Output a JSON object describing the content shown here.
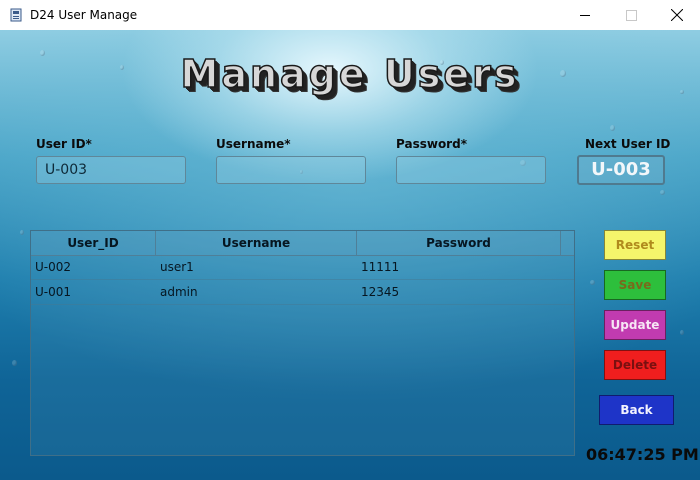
{
  "window": {
    "title": "D24 User Manage",
    "icon": "app-icon"
  },
  "page": {
    "heading": "Manage Users"
  },
  "form": {
    "user_id": {
      "label": "User ID*",
      "value": "U-003"
    },
    "username": {
      "label": "Username*",
      "value": ""
    },
    "password": {
      "label": "Password*",
      "value": ""
    },
    "next_user_id": {
      "label": "Next User ID",
      "value": "U-003"
    }
  },
  "table": {
    "columns": [
      "User_ID",
      "Username",
      "Password"
    ],
    "rows": [
      [
        "U-002",
        "user1",
        "11111"
      ],
      [
        "U-001",
        "admin",
        "12345"
      ]
    ]
  },
  "buttons": {
    "reset": {
      "label": "Reset",
      "bg": "#f5f56b",
      "fg": "#b08a1c"
    },
    "save": {
      "label": "Save",
      "bg": "#2dbf3c",
      "fg": "#7a6a1c"
    },
    "update": {
      "label": "Update",
      "bg": "#c13bb0",
      "fg": "#f7e6f5"
    },
    "delete": {
      "label": "Delete",
      "bg": "#f01e1e",
      "fg": "#7a1010"
    },
    "back": {
      "label": "Back",
      "bg": "#1e34c8",
      "fg": "#f2f2ff"
    }
  },
  "status": {
    "clock": "06:47:25 PM"
  }
}
